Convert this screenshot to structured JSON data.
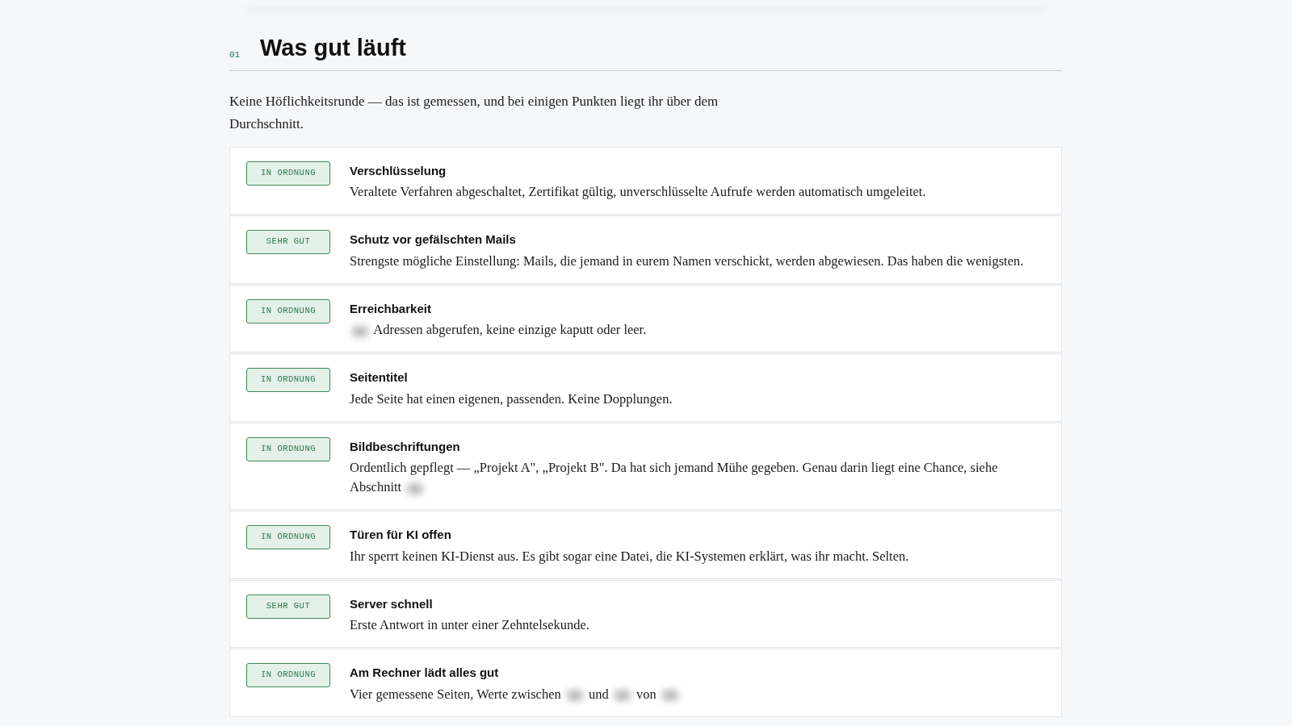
{
  "section": {
    "number": "01",
    "title": "Was gut läuft",
    "intro": "Keine Höflichkeitsrunde — das ist gemessen, und bei einigen Punkten liegt ihr über dem Durchschnitt."
  },
  "findings": [
    {
      "status": "IN ORDNUNG",
      "title": "Verschlüsselung",
      "description": [
        {
          "kind": "text",
          "text": "Veraltete Verfahren abgeschaltet, Zertifikat gültig, unverschlüsselte Aufrufe werden automatisch umgeleitet."
        }
      ]
    },
    {
      "status": "SEHR GUT",
      "title": "Schutz vor gefälschten Mails",
      "description": [
        {
          "kind": "text",
          "text": "Strengste mögliche Einstellung: Mails, die jemand in eurem Namen verschickt, werden abgewiesen. Das haben die wenigsten."
        }
      ]
    },
    {
      "status": "IN ORDNUNG",
      "title": "Erreichbarkeit",
      "description": [
        {
          "kind": "redacted"
        },
        {
          "kind": "text",
          "text": "Adressen abgerufen, keine einzige kaputt oder leer."
        }
      ]
    },
    {
      "status": "IN ORDNUNG",
      "title": "Seitentitel",
      "description": [
        {
          "kind": "text",
          "text": "Jede Seite hat einen eigenen, passenden. Keine Dopplungen."
        }
      ]
    },
    {
      "status": "IN ORDNUNG",
      "title": "Bildbeschriftungen",
      "description": [
        {
          "kind": "text",
          "text": "Ordentlich gepflegt — „Projekt A\", „Projekt B\". Da hat sich jemand Mühe gegeben. Genau darin liegt eine Chance, siehe Abschnitt"
        },
        {
          "kind": "redacted"
        }
      ]
    },
    {
      "status": "IN ORDNUNG",
      "title": "Türen für KI offen",
      "description": [
        {
          "kind": "text",
          "text": "Ihr sperrt keinen KI-Dienst aus. Es gibt sogar eine Datei, die KI-Systemen erklärt, was ihr macht. Selten."
        }
      ]
    },
    {
      "status": "SEHR GUT",
      "title": "Server schnell",
      "description": [
        {
          "kind": "text",
          "text": "Erste Antwort in unter einer Zehntelsekunde."
        }
      ]
    },
    {
      "status": "IN ORDNUNG",
      "title": "Am Rechner lädt alles gut",
      "description": [
        {
          "kind": "text",
          "text": "Vier gemessene Seiten, Werte zwischen"
        },
        {
          "kind": "redacted"
        },
        {
          "kind": "text",
          "text": "und"
        },
        {
          "kind": "redacted"
        },
        {
          "kind": "text",
          "text": "von"
        },
        {
          "kind": "redacted"
        }
      ]
    }
  ]
}
